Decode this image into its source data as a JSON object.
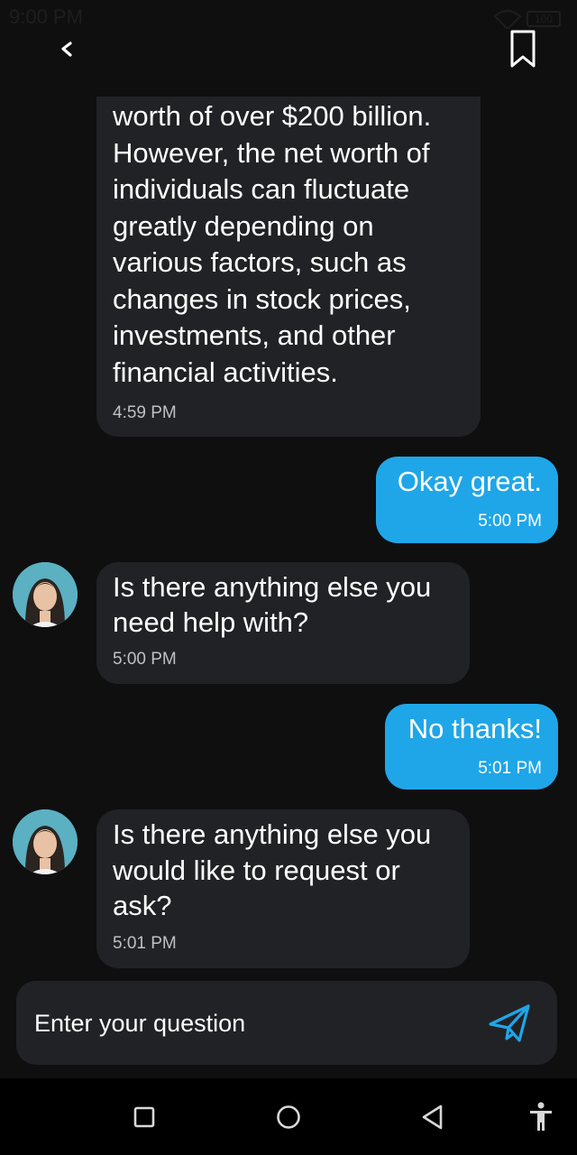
{
  "status_bar": {
    "time": "9:00 PM",
    "battery": "100"
  },
  "header": {
    "back_icon": "chevron-left-icon",
    "bookmark_icon": "bookmark-icon"
  },
  "messages": [
    {
      "sender": "bot",
      "lines": [
        "worth of over $200 billion.",
        "However, the net worth of",
        "individuals can fluctuate",
        "greatly depending on",
        "various factors, such as",
        "changes in stock prices,",
        "investments, and other",
        "financial activities."
      ],
      "time": "4:59 PM"
    },
    {
      "sender": "user",
      "lines": [
        "Okay great."
      ],
      "time": "5:00 PM"
    },
    {
      "sender": "bot",
      "lines": [
        "Is there anything else you",
        "need help with?"
      ],
      "time": "5:00 PM"
    },
    {
      "sender": "user",
      "lines": [
        "No thanks!"
      ],
      "time": "5:01 PM"
    },
    {
      "sender": "bot",
      "lines": [
        "Is there anything else you",
        "would like to request or",
        "ask?"
      ],
      "time": "5:01 PM"
    }
  ],
  "input": {
    "placeholder": "Enter your question",
    "value": "",
    "send_icon": "send-icon"
  },
  "nav_bar": {
    "icons": [
      "recent-apps-icon",
      "home-icon",
      "back-triangle-icon",
      "accessibility-icon"
    ]
  },
  "colors": {
    "background": "#0f0f10",
    "bot_bubble": "#212225",
    "user_bubble": "#1fa6e8",
    "accent": "#1fa6e8"
  }
}
